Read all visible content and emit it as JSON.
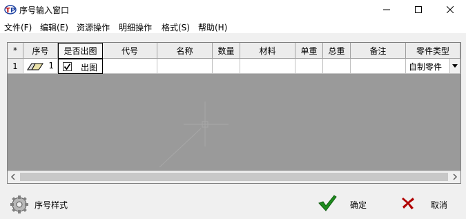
{
  "window": {
    "title": "序号输入窗口"
  },
  "menu": [
    {
      "label": "文件(F)"
    },
    {
      "label": "编辑(E)"
    },
    {
      "label": "资源操作"
    },
    {
      "label": "明细操作"
    },
    {
      "label": "格式(S)"
    },
    {
      "label": "帮助(H)"
    }
  ],
  "grid": {
    "columns": [
      "*",
      "序号",
      "是否出图",
      "代号",
      "名称",
      "数量",
      "材料",
      "单重",
      "总重",
      "备注",
      "零件类型"
    ],
    "rows": [
      {
        "indicator": "1",
        "seq": "1",
        "print_checked": true,
        "print_label": "出图",
        "code": "",
        "name": "",
        "qty": "",
        "material": "",
        "unit_weight": "",
        "total_weight": "",
        "remark": "",
        "part_type": "自制零件"
      }
    ]
  },
  "footer": {
    "style_label": "序号样式",
    "ok_label": "确定",
    "cancel_label": "取消"
  },
  "colors": {
    "ok_green": "#1e8c1e",
    "cancel_red": "#b00000",
    "grid_bg": "#9a9a9a"
  }
}
